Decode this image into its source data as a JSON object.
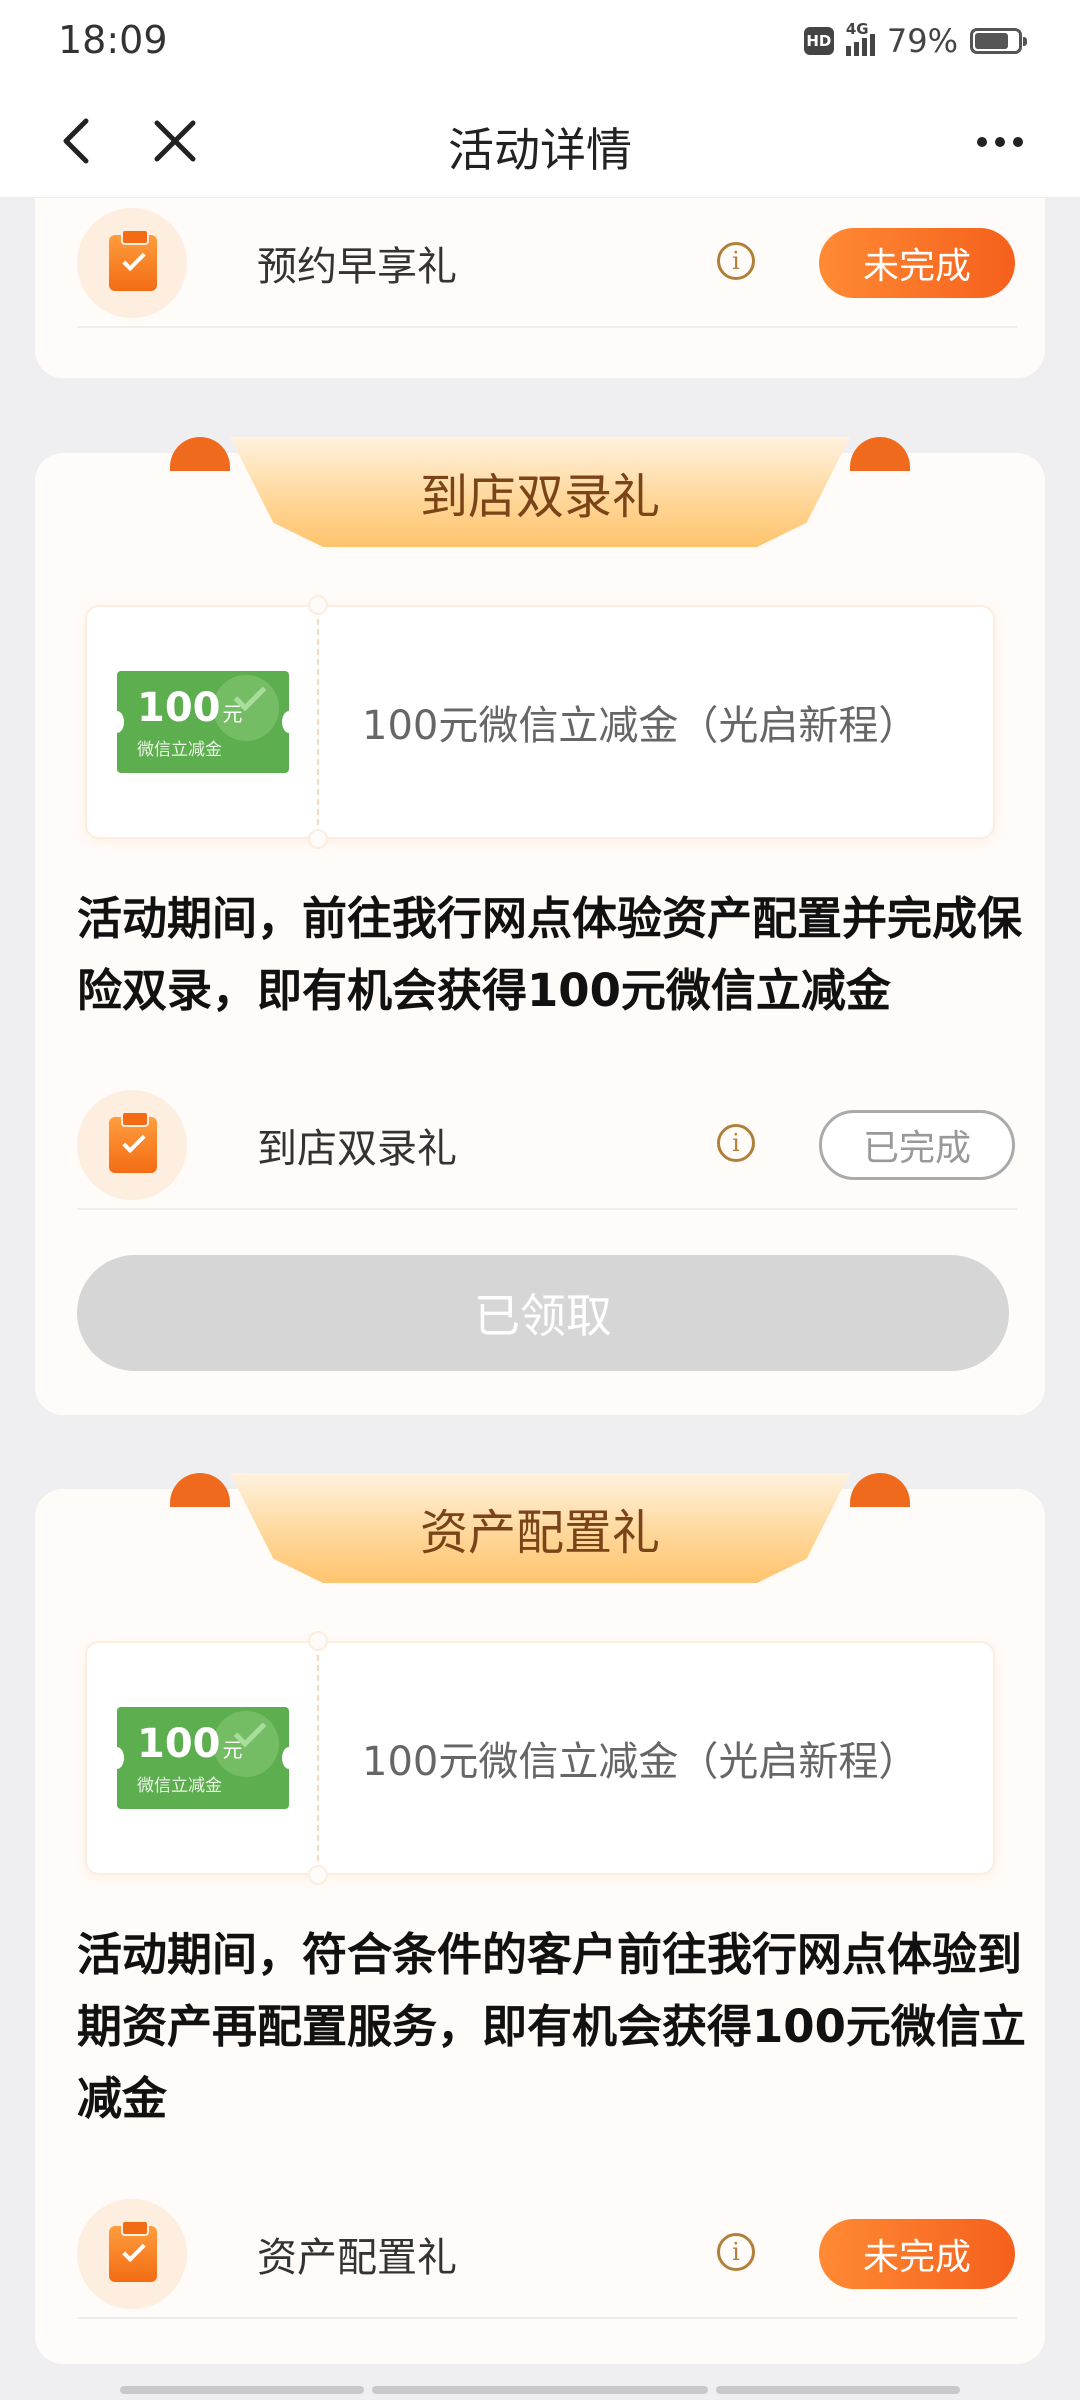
{
  "status_bar": {
    "time": "18:09",
    "hd": "HD",
    "network": "4G",
    "battery_text": "79%",
    "battery_level": 0.79
  },
  "nav": {
    "title": "活动详情",
    "back_icon": "chevron-left-icon",
    "close_icon": "close-icon",
    "more_icon": "more-dots-icon"
  },
  "top_card": {
    "task": {
      "label": "预约早享礼",
      "status": "未完成"
    }
  },
  "sections": [
    {
      "ribbon_title": "到店双录礼",
      "coupon": {
        "amount": "100",
        "unit": "元",
        "sub_label": "微信立减金",
        "title": "100元微信立减金（光启新程）"
      },
      "description_lines": [
        "活动期间，前往我行网点体验资产配置并完成保",
        "险双录，即有机会获得100元微信立减金"
      ],
      "task": {
        "label": "到店双录礼",
        "status": "已完成"
      },
      "claim_button": "已领取"
    },
    {
      "ribbon_title": "资产配置礼",
      "coupon": {
        "amount": "100",
        "unit": "元",
        "sub_label": "微信立减金",
        "title": "100元微信立减金（光启新程）"
      },
      "description_lines": [
        "活动期间，符合条件的客户前往我行网点体验到",
        "期资产再配置服务，即有机会获得100元微信立",
        "减金"
      ],
      "task": {
        "label": "资产配置礼",
        "status": "未完成"
      }
    }
  ],
  "colors": {
    "accent_orange": "#f5601c",
    "ribbon_gold": "#ffc46e",
    "voucher_green": "#5dae4e",
    "disabled_gray": "#d6d6d6"
  }
}
